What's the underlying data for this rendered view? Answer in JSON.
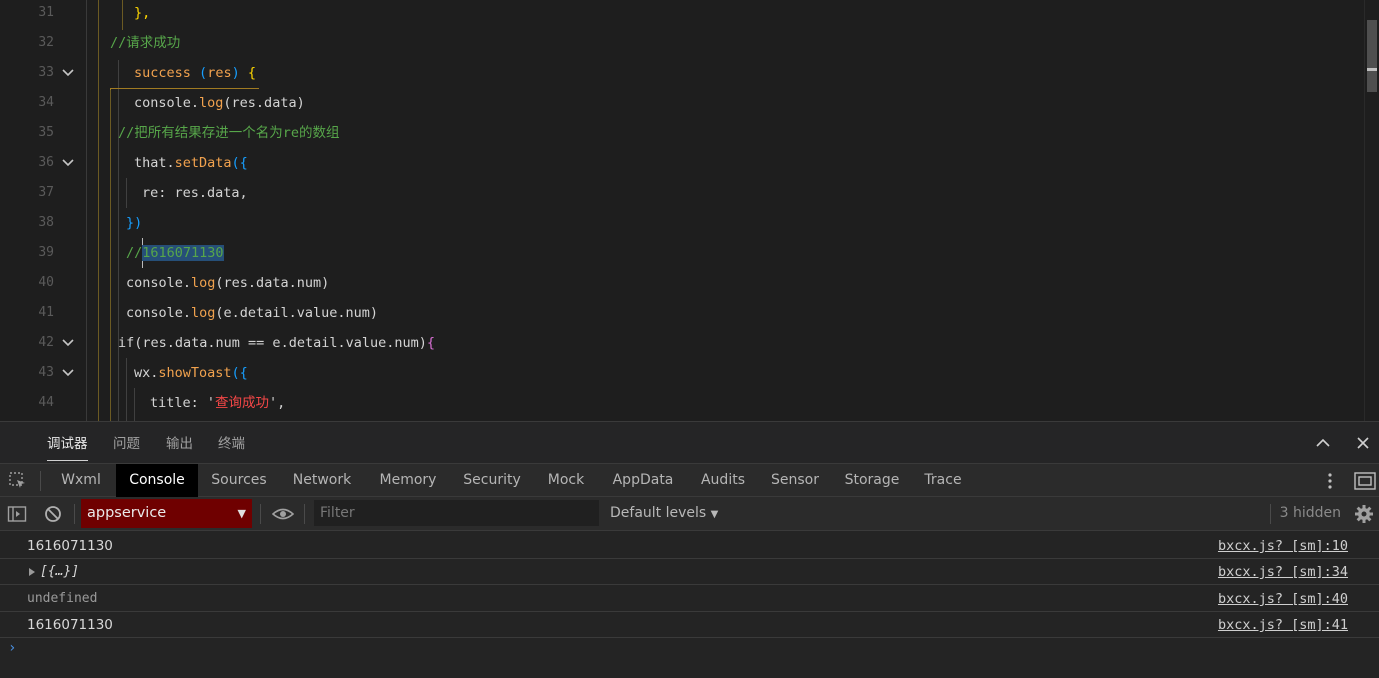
{
  "editor": {
    "line_numbers": [
      "31",
      "32",
      "33",
      "34",
      "35",
      "36",
      "37",
      "38",
      "39",
      "40",
      "41",
      "42",
      "43",
      "44"
    ],
    "lines": [
      {
        "segments": [
          {
            "t": "},",
            "c": "t-brace"
          }
        ]
      },
      {
        "segments": [
          {
            "t": "//请求成功",
            "c": "t-cm2"
          }
        ]
      },
      {
        "segments": [
          {
            "t": "success",
            "c": "t-fn"
          },
          {
            "t": " ",
            "c": "t-punc"
          },
          {
            "t": "(",
            "c": "t-brace3"
          },
          {
            "t": "res",
            "c": "t-fn"
          },
          {
            "t": ")",
            "c": "t-brace3"
          },
          {
            "t": " {",
            "c": "t-brace"
          }
        ]
      },
      {
        "segments": [
          {
            "t": "console.",
            "c": "t-punc"
          },
          {
            "t": "log",
            "c": "t-fn"
          },
          {
            "t": "(res.data)",
            "c": "t-punc"
          }
        ]
      },
      {
        "segments": [
          {
            "t": "//把所有结果存进一个名为re的数组",
            "c": "t-cm2"
          }
        ]
      },
      {
        "segments": [
          {
            "t": "that.",
            "c": "t-punc"
          },
          {
            "t": "setData",
            "c": "t-fn"
          },
          {
            "t": "({",
            "c": "t-brace3"
          }
        ]
      },
      {
        "segments": [
          {
            "t": "re: res.data,",
            "c": "t-punc"
          }
        ]
      },
      {
        "segments": [
          {
            "t": "})",
            "c": "t-brace3"
          }
        ]
      },
      {
        "segments": [
          {
            "t": "//",
            "c": "t-cm2"
          },
          {
            "t": "1616071130",
            "c": "t-cm2 sel"
          }
        ]
      },
      {
        "segments": [
          {
            "t": "console.",
            "c": "t-punc"
          },
          {
            "t": "log",
            "c": "t-fn"
          },
          {
            "t": "(res.data.num)",
            "c": "t-punc"
          }
        ]
      },
      {
        "segments": [
          {
            "t": "console.",
            "c": "t-punc"
          },
          {
            "t": "log",
            "c": "t-fn"
          },
          {
            "t": "(e.detail.value.num)",
            "c": "t-punc"
          }
        ]
      },
      {
        "segments": [
          {
            "t": "if",
            "c": "t-kw"
          },
          {
            "t": "(res.data.num == e.detail.value.num)",
            "c": "t-punc"
          },
          {
            "t": "{",
            "c": "t-brace2"
          }
        ]
      },
      {
        "segments": [
          {
            "t": "wx.",
            "c": "t-punc"
          },
          {
            "t": "showToast",
            "c": "t-fn"
          },
          {
            "t": "({",
            "c": "t-brace3"
          }
        ]
      },
      {
        "segments": [
          {
            "t": "title: ",
            "c": "t-punc"
          },
          {
            "t": "'",
            "c": "t-punc"
          },
          {
            "t": "查询成功",
            "c": "t-str"
          },
          {
            "t": "',",
            "c": "t-punc"
          }
        ]
      }
    ]
  },
  "panel_tabs": [
    "调试器",
    "问题",
    "输出",
    "终端"
  ],
  "devtools_tabs": [
    "Wxml",
    "Console",
    "Sources",
    "Network",
    "Memory",
    "Security",
    "Mock",
    "AppData",
    "Audits",
    "Sensor",
    "Storage",
    "Trace"
  ],
  "console_toolbar": {
    "context": "appservice",
    "filter_placeholder": "Filter",
    "levels": "Default levels",
    "hidden": "3 hidden"
  },
  "console_rows": [
    {
      "msg": "1616071130",
      "src": "bxcx.js? [sm]:10"
    },
    {
      "msg": "[{…}]",
      "src": "bxcx.js? [sm]:34"
    },
    {
      "msg": "undefined",
      "src": "bxcx.js? [sm]:40"
    },
    {
      "msg": "1616071130",
      "src": "bxcx.js? [sm]:41"
    }
  ],
  "prompt_symbol": "›",
  "icons": [
    "chevron-down-icon",
    "chevron-up-icon",
    "close-icon",
    "inspect-icon",
    "more-icon",
    "dock-icon",
    "sidebar-toggle-icon",
    "clear-icon",
    "eye-icon",
    "gear-icon",
    "expand-triangle-icon"
  ]
}
